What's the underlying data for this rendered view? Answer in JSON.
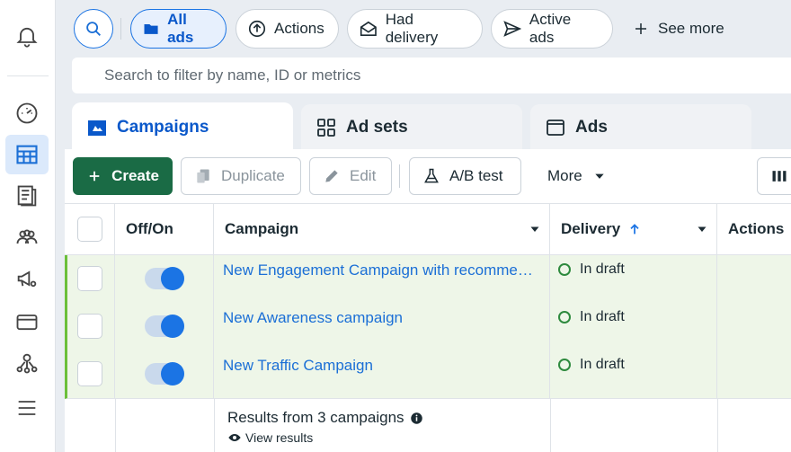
{
  "filters": {
    "pills": [
      {
        "label": "All ads",
        "icon": "folder-icon",
        "active": true
      },
      {
        "label": "Actions",
        "icon": "arrow-up-circle-icon",
        "active": false
      },
      {
        "label": "Had delivery",
        "icon": "envelope-open-icon",
        "active": false
      },
      {
        "label": "Active ads",
        "icon": "send-icon",
        "active": false
      }
    ],
    "see_more": "See more",
    "search_placeholder": "Search to filter by name, ID or metrics"
  },
  "tabs": [
    {
      "label": "Campaigns",
      "icon": "campaign-folder-icon",
      "active": true
    },
    {
      "label": "Ad sets",
      "icon": "grid-icon",
      "active": false
    },
    {
      "label": "Ads",
      "icon": "window-icon",
      "active": false
    }
  ],
  "toolbar": {
    "create": "Create",
    "duplicate": "Duplicate",
    "edit": "Edit",
    "ab_test": "A/B test",
    "more": "More"
  },
  "table": {
    "columns": [
      "Off/On",
      "Campaign",
      "Delivery",
      "Actions"
    ],
    "rows": [
      {
        "campaign": "New Engagement Campaign with recommen...",
        "delivery": "In draft",
        "on": true
      },
      {
        "campaign": "New Awareness campaign",
        "delivery": "In draft",
        "on": true
      },
      {
        "campaign": "New Traffic Campaign",
        "delivery": "In draft",
        "on": true
      }
    ],
    "results_text": "Results from 3 campaigns",
    "view_results": "View results"
  },
  "colors": {
    "accent": "#1b74e4",
    "create_button": "#1a6b45",
    "row_highlight": "#eef6e8",
    "status_draft": "#2e8a3e"
  }
}
